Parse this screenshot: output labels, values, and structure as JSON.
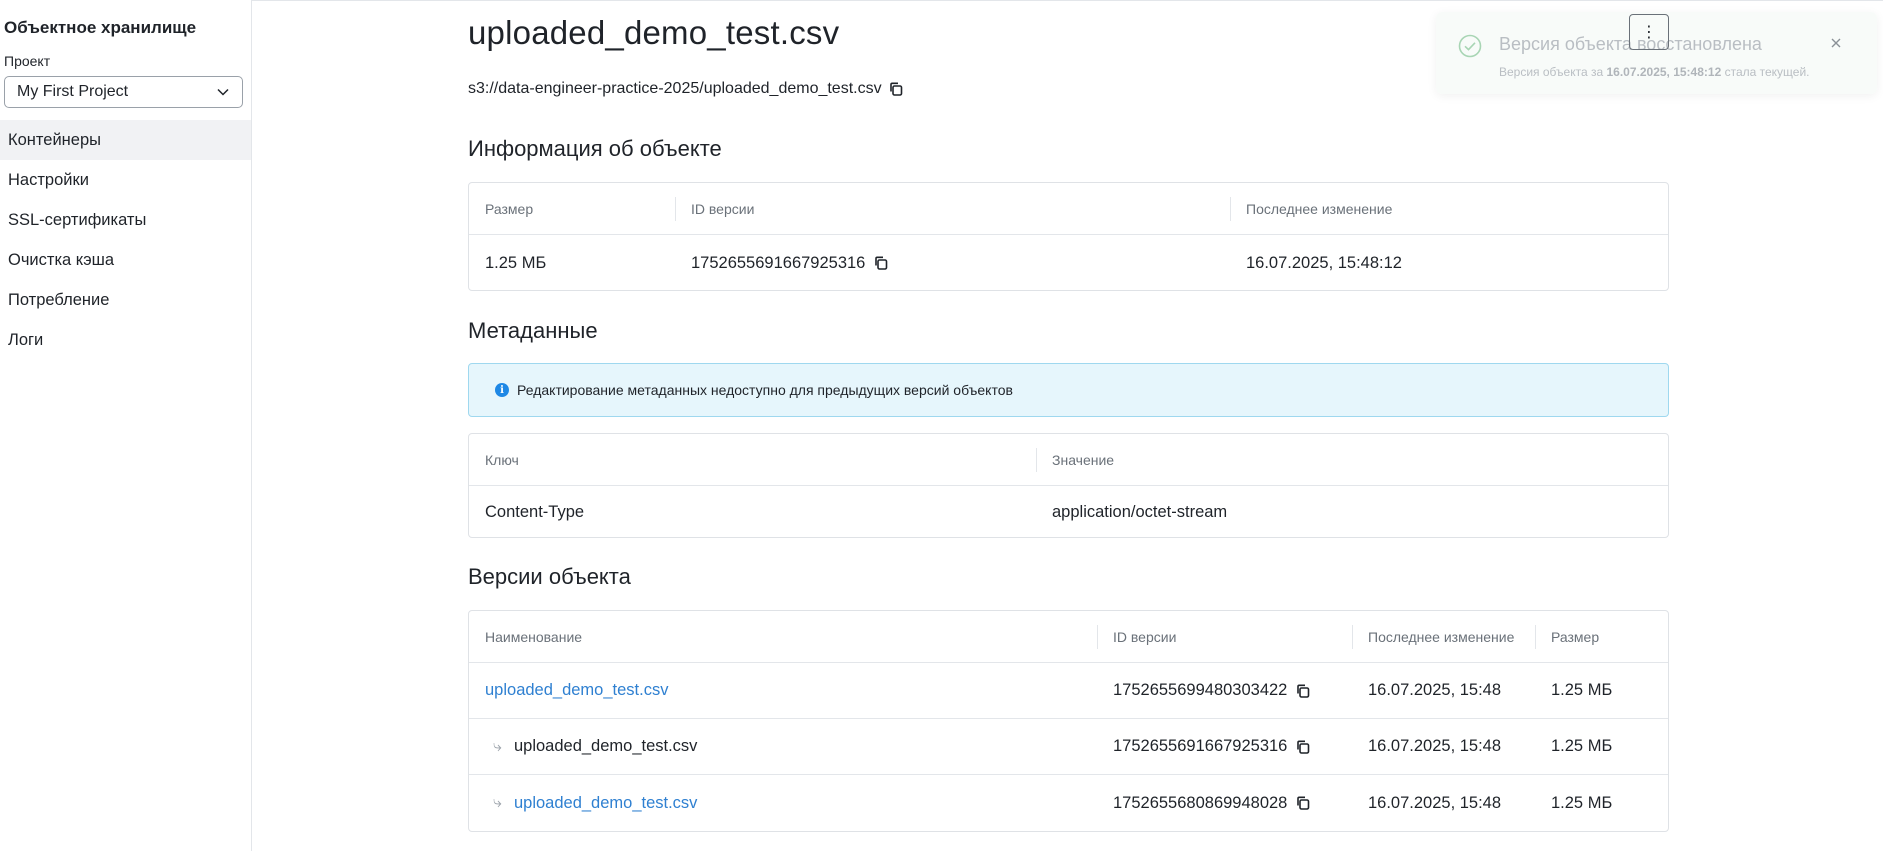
{
  "sidebar": {
    "title": "Объектное хранилище",
    "project_label": "Проект",
    "project_value": "My First Project",
    "items": [
      {
        "label": "Контейнеры",
        "active": true
      },
      {
        "label": "Настройки"
      },
      {
        "label": "SSL-сертификаты"
      },
      {
        "label": "Очистка кэша"
      },
      {
        "label": "Потребление"
      },
      {
        "label": "Логи"
      }
    ]
  },
  "object": {
    "name": "uploaded_demo_test.csv",
    "path": "s3://data-engineer-practice-2025/uploaded_demo_test.csv"
  },
  "info_section": {
    "title": "Информация об объекте",
    "headers": [
      "Размер",
      "ID версии",
      "Последнее изменение"
    ],
    "size": "1.25 МБ",
    "version_id": "1752655691667925316",
    "modified": "16.07.2025, 15:48:12"
  },
  "metadata_section": {
    "title": "Метаданные",
    "notice": "Редактирование метаданных недоступно для предыдущих версий объектов",
    "headers": [
      "Ключ",
      "Значение"
    ],
    "rows": [
      {
        "key": "Content-Type",
        "value": "application/octet-stream"
      }
    ]
  },
  "versions_section": {
    "title": "Версии объекта",
    "headers": [
      "Наименование",
      "ID версии",
      "Последнее изменение",
      "Размер"
    ],
    "rows": [
      {
        "name": "uploaded_demo_test.csv",
        "version_id": "1752655699480303422",
        "modified": "16.07.2025, 15:48",
        "size": "1.25 МБ"
      },
      {
        "name": "uploaded_demo_test.csv",
        "version_id": "1752655691667925316",
        "modified": "16.07.2025, 15:48",
        "size": "1.25 МБ"
      },
      {
        "name": "uploaded_demo_test.csv",
        "version_id": "1752655680869948028",
        "modified": "16.07.2025, 15:48",
        "size": "1.25 МБ"
      }
    ]
  },
  "toast": {
    "title": "Версия объекта восстановлена",
    "text_prefix": "Версия объекта за",
    "text_date": "16.07.2025, 15:48:12",
    "text_suffix": "стала текущей."
  },
  "menu_label": "⋮",
  "colors": {
    "link": "#2f80d1",
    "info_bg": "#e6f6fc",
    "info_border": "#9fd8ef",
    "success": "#7fbf8e"
  }
}
